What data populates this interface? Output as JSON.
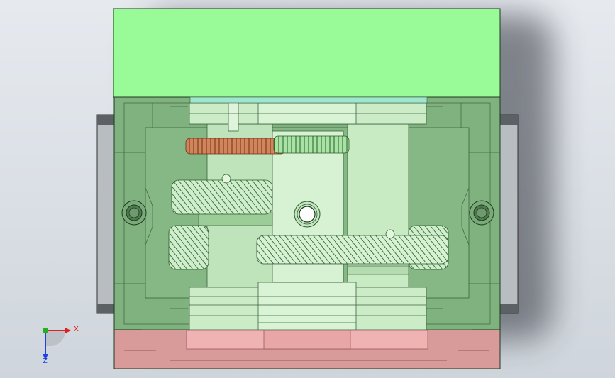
{
  "viewport": {
    "colors": {
      "background_top": "#e6eaef",
      "background_bottom": "#cfd5dc",
      "shadow": "#2d333b",
      "cover_top": "#98fb98",
      "housing": "#7fb27f",
      "base": "#d99a9a",
      "side_flange": "#b8bdc2",
      "pale_gear": "#cfeecb",
      "orange_gear": "#d2845a",
      "edge": "#1e3b1e"
    },
    "parts": {
      "top_cover": "top-cover",
      "housing": "gear-housing",
      "base": "base-plate",
      "left_flange": "left-flange",
      "right_flange": "right-flange"
    }
  },
  "triad": {
    "x_label": "X",
    "z_label": "Z",
    "x_color": "#e02020",
    "y_color": "#20b020",
    "z_color": "#2040e0"
  }
}
